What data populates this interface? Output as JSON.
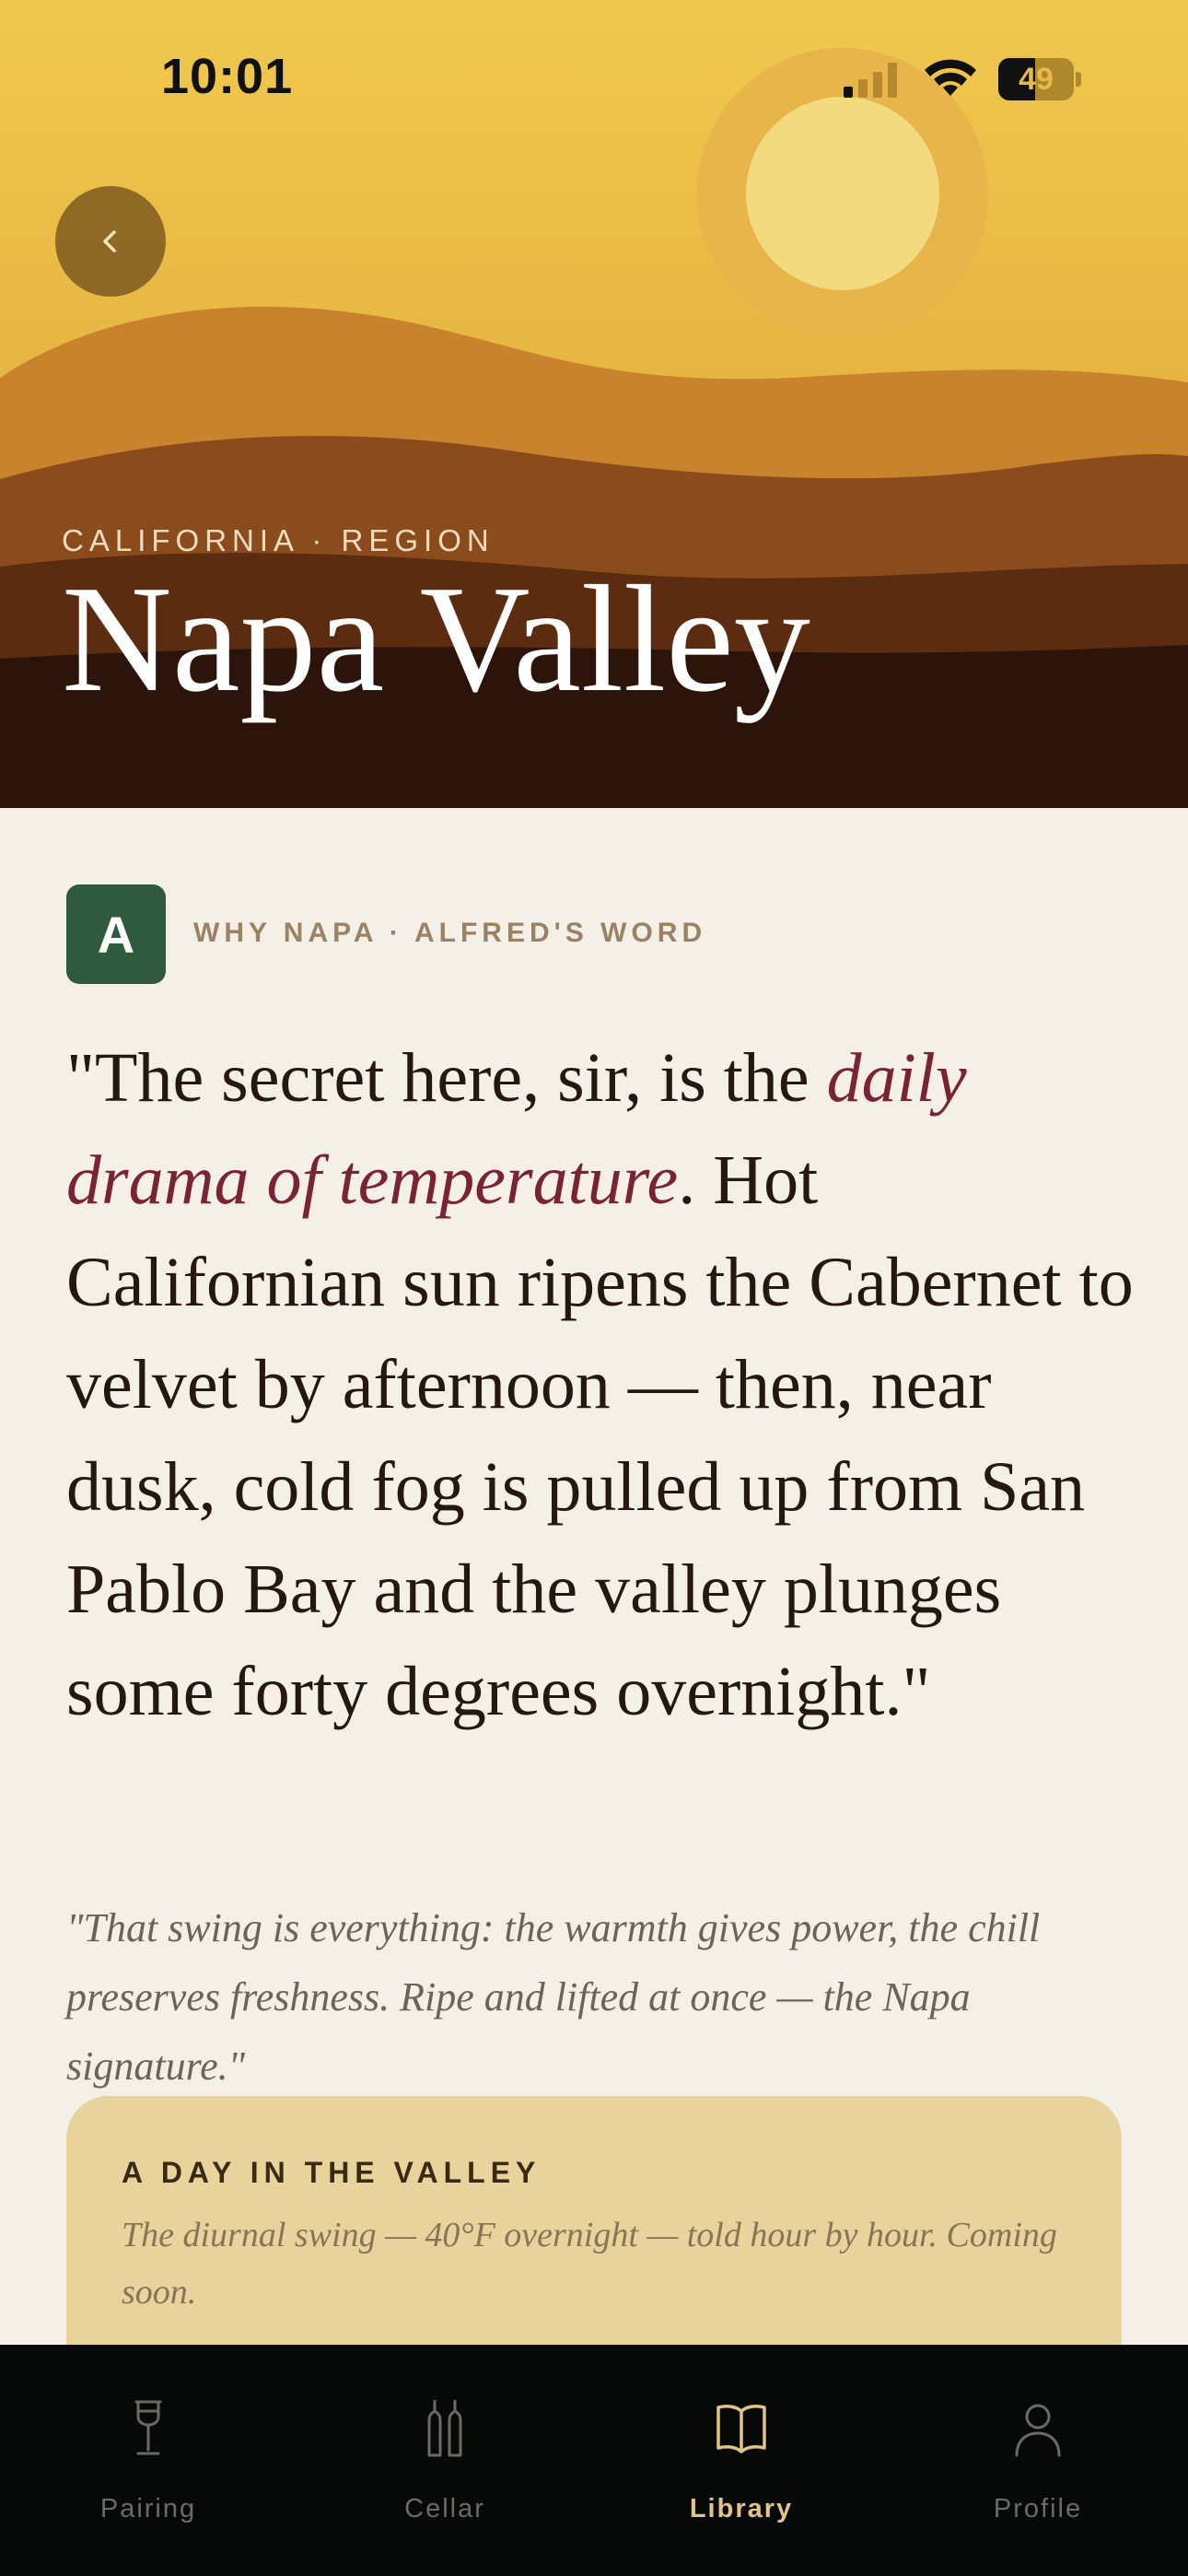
{
  "status_bar": {
    "time": "10:01",
    "battery": "49",
    "battery_level": 0.49
  },
  "hero": {
    "region_label": "CALIFORNIA · REGION",
    "title": "Napa Valley"
  },
  "section": {
    "avatar_letter": "A",
    "label": "WHY NAPA · ALFRED'S WORD"
  },
  "quote": {
    "before": "\"The secret here, sir, is the ",
    "accent": "daily drama of temperature",
    "after": ". Hot Californian sun ripens the Cabernet to velvet by afternoon — then, near dusk, cold fog is pulled up from San Pablo Bay and the valley plunges some forty degrees overnight.\""
  },
  "subquote": "\"That swing is everything: the warmth gives power, the chill preserves freshness. Ripe and lifted at once — the Napa signature.\"",
  "card": {
    "title": "A DAY IN THE VALLEY",
    "text": "The diurnal swing — 40°F overnight — told hour by hour. Coming soon."
  },
  "tabs": [
    {
      "label": "Pairing",
      "icon": "wine-glass-icon",
      "active": false
    },
    {
      "label": "Cellar",
      "icon": "bottles-icon",
      "active": false
    },
    {
      "label": "Library",
      "icon": "book-icon",
      "active": true
    },
    {
      "label": "Profile",
      "icon": "person-icon",
      "active": false
    }
  ],
  "colors": {
    "accent_wine": "#7a2333",
    "avatar_green": "#2f5a3f",
    "tab_active": "#e3c487",
    "card_bg": "#e8d39d"
  }
}
